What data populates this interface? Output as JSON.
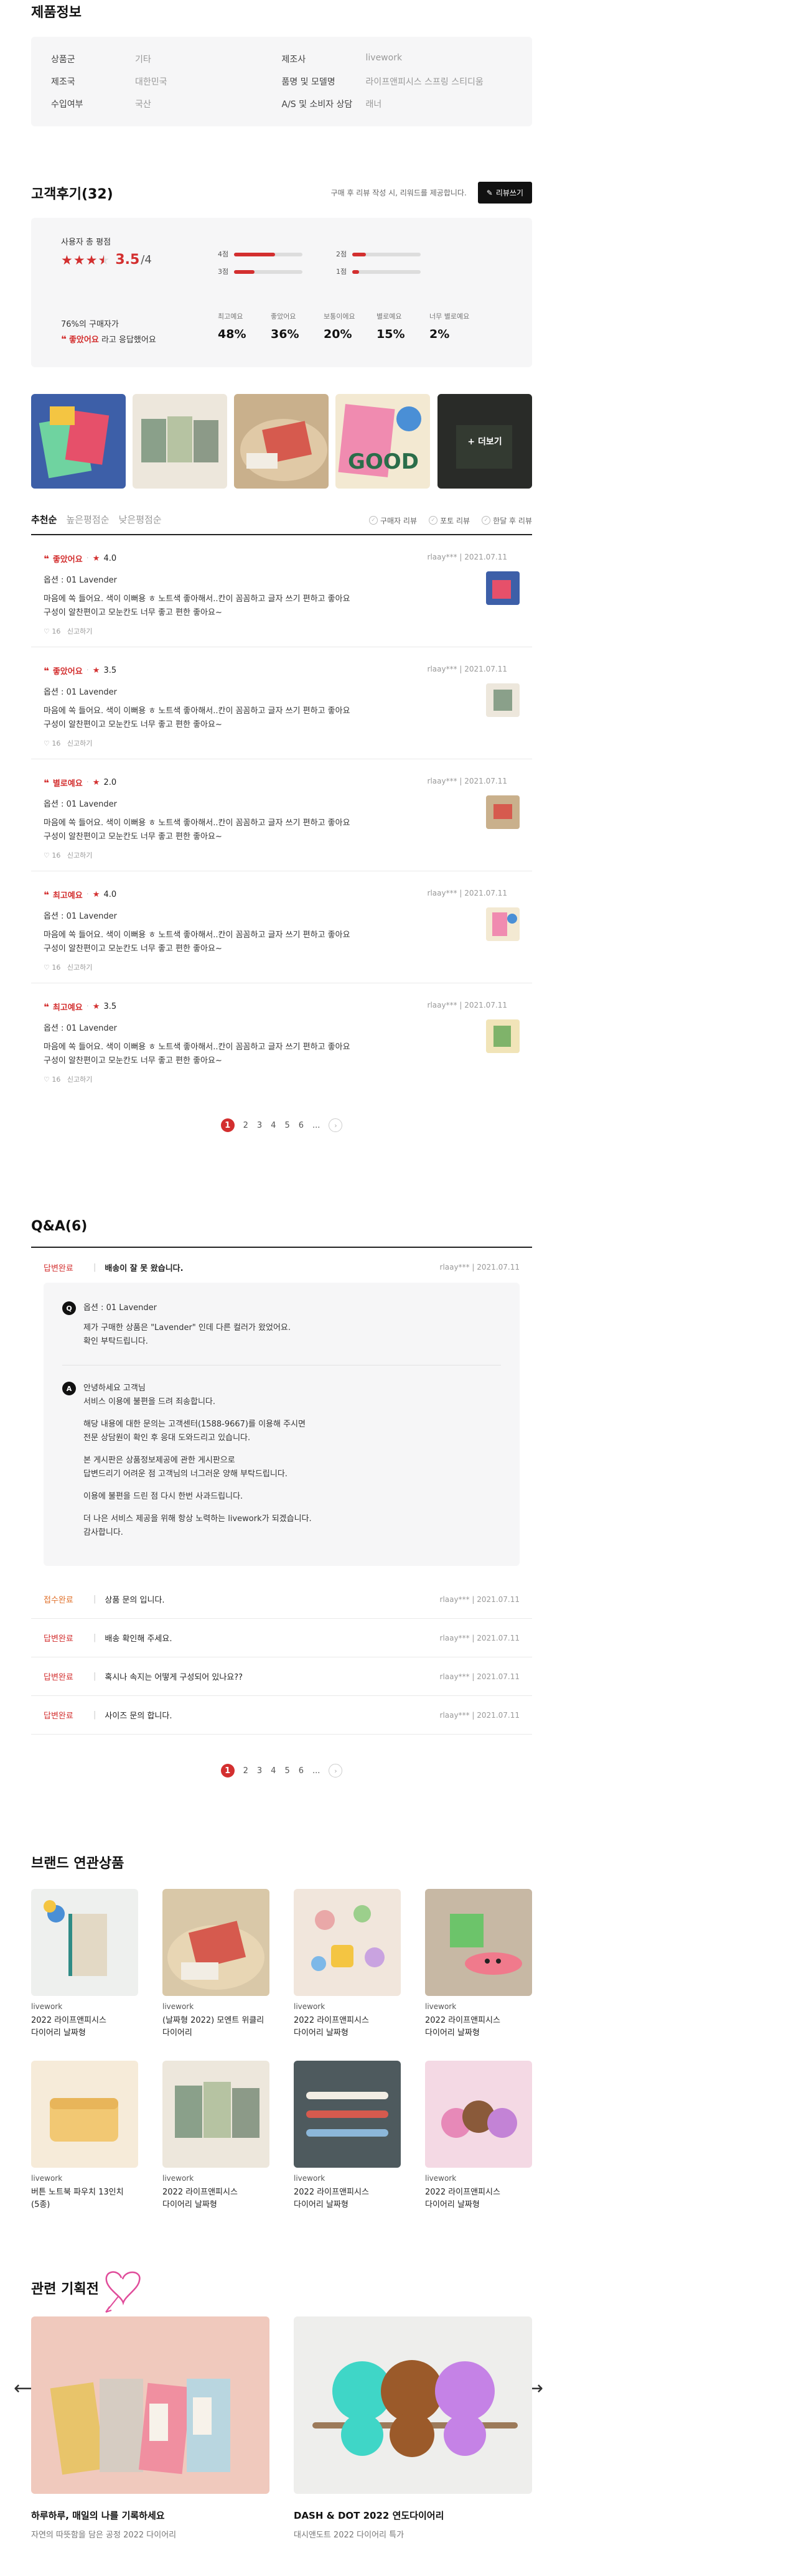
{
  "product_info": {
    "title": "제품정보",
    "rows": [
      {
        "k": "상품군",
        "v": "기타"
      },
      {
        "k": "제조사",
        "v": "livework"
      },
      {
        "k": "제조국",
        "v": "대한민국"
      },
      {
        "k": "품명 및 모델명",
        "v": "라이프앤피시스 스프링 스티디움"
      },
      {
        "k": "수입여부",
        "v": "국산"
      },
      {
        "k": "A/S 및 소비자 상담",
        "v": "래너"
      }
    ]
  },
  "reviews": {
    "title": "고객후기(32)",
    "note": "구매 후 리뷰 작성 시, 리워드를 제공합니다.",
    "write_label": "리뷰쓰기",
    "summary": {
      "label": "사용자 총 평점",
      "score": "3.5",
      "max": "/4",
      "stars_fraction": 0.875,
      "dist": [
        {
          "label": "4점",
          "value": 0.6
        },
        {
          "label": "2점",
          "value": 0.2
        },
        {
          "label": "3점",
          "value": 0.3
        },
        {
          "label": "1점",
          "value": 0.1
        }
      ],
      "recommend_line1": "76%의 구매자가",
      "recommend_highlight": "좋았어요",
      "recommend_line2": "라고 응답했어요",
      "stats": [
        {
          "label": "최고예요",
          "value": "48%"
        },
        {
          "label": "좋았어요",
          "value": "36%"
        },
        {
          "label": "보통이에요",
          "value": "20%"
        },
        {
          "label": "별로예요",
          "value": "15%"
        },
        {
          "label": "너무 별로예요",
          "value": "2%"
        }
      ]
    },
    "more_label": "+ 더보기",
    "sort": [
      "추천순",
      "높은평점순",
      "낮은평점순"
    ],
    "filters": [
      "구매자 리뷰",
      "포토 리뷰",
      "한달 후 리뷰"
    ],
    "items": [
      {
        "label": "좋았어요",
        "rating": "4.0",
        "user": "rlaay***",
        "date": "2021.07.11",
        "option": "옵션 : 01 Lavender",
        "text1": "마음에 쏙 들어요. 색이 이뻐용 ㅎ 노트색 좋아해서..칸이 꼼꼼하고 글자 쓰기 편하고 좋아요",
        "text2": "구성이 알찬편이고 모눈칸도 너무 좋고 편한 좋아요~",
        "likes": "16",
        "like_label": "신고하기"
      },
      {
        "label": "좋았어요",
        "rating": "3.5",
        "user": "rlaay***",
        "date": "2021.07.11",
        "option": "옵션 : 01 Lavender",
        "text1": "마음에 쏙 들어요. 색이 이뻐용 ㅎ 노트색 좋아해서..칸이 꼼꼼하고 글자 쓰기 편하고 좋아요",
        "text2": "구성이 알찬편이고 모눈칸도 너무 좋고 편한 좋아요~",
        "likes": "16",
        "like_label": "신고하기"
      },
      {
        "label": "별로예요",
        "rating": "2.0",
        "user": "rlaay***",
        "date": "2021.07.11",
        "option": "옵션 : 01 Lavender",
        "text1": "마음에 쏙 들어요. 색이 이뻐용 ㅎ 노트색 좋아해서..칸이 꼼꼼하고 글자 쓰기 편하고 좋아요",
        "text2": "구성이 알찬편이고 모눈칸도 너무 좋고 편한 좋아요~",
        "likes": "16",
        "like_label": "신고하기"
      },
      {
        "label": "최고예요",
        "rating": "4.0",
        "user": "rlaay***",
        "date": "2021.07.11",
        "option": "옵션 : 01 Lavender",
        "text1": "마음에 쏙 들어요. 색이 이뻐용 ㅎ 노트색 좋아해서..칸이 꼼꼼하고 글자 쓰기 편하고 좋아요",
        "text2": "구성이 알찬편이고 모눈칸도 너무 좋고 편한 좋아요~",
        "likes": "16",
        "like_label": "신고하기"
      },
      {
        "label": "최고예요",
        "rating": "3.5",
        "user": "rlaay***",
        "date": "2021.07.11",
        "option": "옵션 : 01 Lavender",
        "text1": "마음에 쏙 들어요. 색이 이뻐용 ㅎ 노트색 좋아해서..칸이 꼼꼼하고 글자 쓰기 편하고 좋아요",
        "text2": "구성이 알찬편이고 모눈칸도 너무 좋고 편한 좋아요~",
        "likes": "16",
        "like_label": "신고하기"
      }
    ],
    "pages": [
      "1",
      "2",
      "3",
      "4",
      "5",
      "6",
      "..."
    ]
  },
  "qa": {
    "title": "Q&A(6)",
    "first": {
      "status": "답변완료",
      "title": "배송이 잘 못 왔습니다.",
      "user": "rlaay***",
      "date": "2021.07.11"
    },
    "question": {
      "badge": "Q",
      "option": "옵션 : 01 Lavender",
      "line1": "제가 구매한 상품은 \"Lavender\" 인데 다른 컬러가 왔었어요.",
      "line2": "확인 부탁드립니다."
    },
    "answer": {
      "badge": "A",
      "lines": [
        "안녕하세요 고객님",
        "서비스 이용에 불편을 드려 죄송합니다.",
        "",
        "해당 내용에 대한 문의는 고객센터(1588-9667)를 이용해 주시면",
        "전문 상담원이 확인 후 응대 도와드리고 있습니다.",
        "",
        "본 게시판은 상품정보제공에 관한 게시판으로",
        "답변드리기 어려운 점 고객님의 너그러운 양해 부탁드립니다.",
        "",
        "이용에 불편을 드린 점 다시 한번 사과드립니다.",
        "",
        "더 나은 서비스 제공을 위해 항상 노력하는 livework가 되겠습니다.",
        "감사합니다."
      ]
    },
    "rows": [
      {
        "status": "접수완료",
        "title": "상품 문의 입니다.",
        "user": "rlaay***",
        "date": "2021.07.11"
      },
      {
        "status": "답변완료",
        "title": "배송 확인해 주세요.",
        "user": "rlaay***",
        "date": "2021.07.11"
      },
      {
        "status": "답변완료",
        "title": "혹시나 속지는 어떻게 구성되어 있나요??",
        "user": "rlaay***",
        "date": "2021.07.11"
      },
      {
        "status": "답변완료",
        "title": "사이즈 문의 합니다.",
        "user": "rlaay***",
        "date": "2021.07.11"
      }
    ],
    "pages": [
      "1",
      "2",
      "3",
      "4",
      "5",
      "6",
      "..."
    ]
  },
  "brand": {
    "title": "브랜드 연관상품",
    "items": [
      {
        "brand": "livework",
        "name1": "2022 라이프앤피시스",
        "name2": "다이어리 날짜형"
      },
      {
        "brand": "livework",
        "name1": "(날짜형 2022) 모엔트 위클리",
        "name2": "다이어리"
      },
      {
        "brand": "livework",
        "name1": "2022 라이프앤피시스",
        "name2": "다이어리 날짜형"
      },
      {
        "brand": "livework",
        "name1": "2022 라이프앤피시스",
        "name2": "다이어리 날짜형"
      },
      {
        "brand": "livework",
        "name1": "버튼 노트북 파우치 13인치",
        "name2": "(5종)"
      },
      {
        "brand": "livework",
        "name1": "2022 라이프앤피시스",
        "name2": "다이어리 날짜형"
      },
      {
        "brand": "livework",
        "name1": "2022 라이프앤피시스",
        "name2": "다이어리 날짜형"
      },
      {
        "brand": "livework",
        "name1": "2022 라이프앤피시스",
        "name2": "다이어리 날짜형"
      }
    ]
  },
  "plans": {
    "title": "관련 기획전",
    "items": [
      {
        "title": "하루하루, 매일의 나를 기록하세요",
        "sub": "자연의 따뜻함을 담은 공정 2022 다이어리"
      },
      {
        "title": "DASH & DOT 2022 연도다이어리",
        "sub": "대시앤도트 2022 다이어리 특가"
      }
    ]
  },
  "colors": {
    "accent": "#d32f2f",
    "box": "#f6f6f7"
  }
}
